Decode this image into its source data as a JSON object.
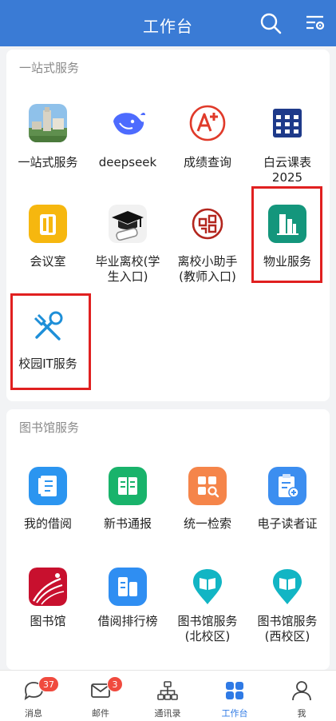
{
  "header": {
    "title": "工作台"
  },
  "section1": {
    "title": "一站式服务",
    "items": [
      {
        "label": "一站式服务"
      },
      {
        "label": "deepseek"
      },
      {
        "label": "成绩查询"
      },
      {
        "label": "白云课表\n2025"
      },
      {
        "label": "会议室"
      },
      {
        "label": "毕业离校(学\n生入口)"
      },
      {
        "label": "离校小助手\n(教师入口)"
      },
      {
        "label": "物业服务"
      },
      {
        "label": "校园IT服务"
      }
    ]
  },
  "section2": {
    "title": "图书馆服务",
    "items": [
      {
        "label": "我的借阅"
      },
      {
        "label": "新书通报"
      },
      {
        "label": "统一检索"
      },
      {
        "label": "电子读者证"
      },
      {
        "label": "图书馆"
      },
      {
        "label": "借阅排行榜"
      },
      {
        "label": "图书馆服务\n(北校区)"
      },
      {
        "label": "图书馆服务\n(西校区)"
      }
    ]
  },
  "tabbar": {
    "tabs": [
      {
        "label": "消息",
        "badge": "37"
      },
      {
        "label": "邮件",
        "badge": "3"
      },
      {
        "label": "通讯录"
      },
      {
        "label": "工作台"
      },
      {
        "label": "我"
      }
    ],
    "active_color": "#2f7ae5"
  },
  "colors": {
    "header": "#3a7bd5",
    "highlight_box": "#e02020"
  }
}
